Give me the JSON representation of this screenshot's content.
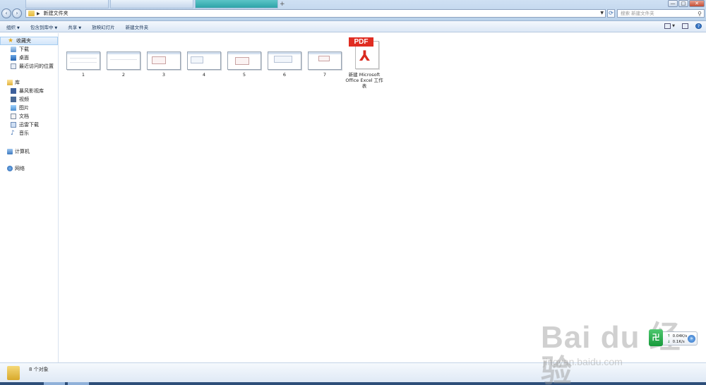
{
  "window": {
    "address_path": "新建文件夹",
    "search_placeholder": "搜索 新建文件夹",
    "buttons": {
      "minimize": "—",
      "maximize": "□",
      "close": "✕"
    }
  },
  "toolbar": {
    "items": [
      "组织",
      "包含到库中",
      "共享",
      "放映幻灯片",
      "新建文件夹"
    ]
  },
  "sidebar": {
    "favorites": {
      "label": "收藏夹",
      "items": [
        "下载",
        "桌面",
        "最近访问的位置"
      ]
    },
    "libraries": {
      "label": "库",
      "items": [
        "暴风影视库",
        "视频",
        "图片",
        "文档",
        "迅雷下载",
        "音乐"
      ]
    },
    "computer": "计算机",
    "network": "网络"
  },
  "files": [
    {
      "name": "1"
    },
    {
      "name": "2"
    },
    {
      "name": "3"
    },
    {
      "name": "4"
    },
    {
      "name": "5"
    },
    {
      "name": "6"
    },
    {
      "name": "7"
    }
  ],
  "pdf_file": {
    "badge": "PDF",
    "name": "新建 Microsoft Office Excel 工作表"
  },
  "status": {
    "text": "8 个对象"
  },
  "netwidget": {
    "up": "0.04K/s",
    "down": "0.1K/s"
  },
  "watermark": {
    "big": "Bai du 经验",
    "small": "jingyan.baidu.com"
  },
  "colors": {
    "pdf_red": "#e02d22",
    "accent": "#3a78c8"
  }
}
